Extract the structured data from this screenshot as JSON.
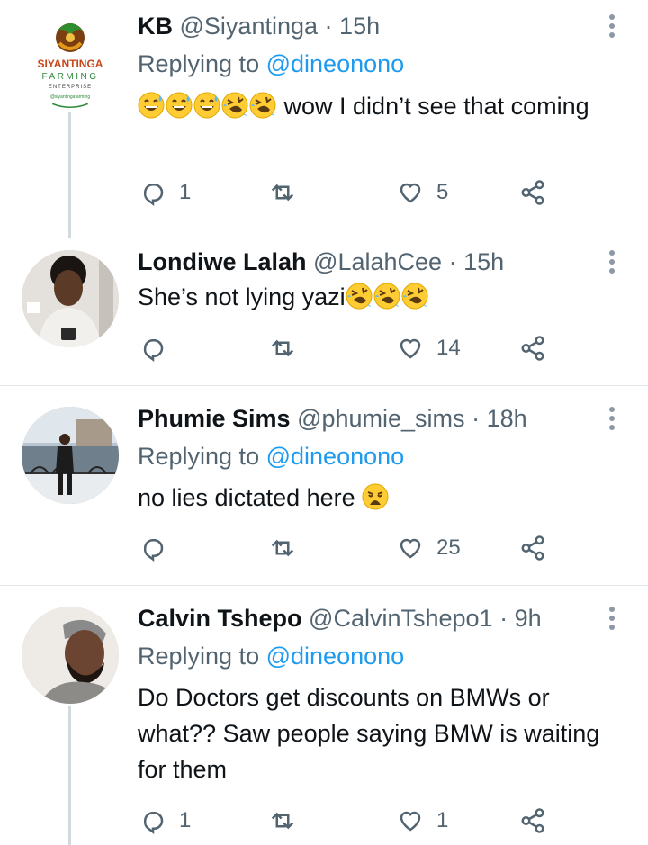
{
  "tweets": [
    {
      "name": "KB",
      "handle": "@Siyantinga",
      "time": "15h",
      "replying_label": "Replying to",
      "replying_handle": "@dineonono",
      "text": "wow I didn’t see that coming",
      "emojis": [
        "grinning-sweat",
        "grinning-sweat",
        "grinning-sweat",
        "rofl",
        "rofl"
      ],
      "replies": "1",
      "retweets": "",
      "likes": "5",
      "avatar_logo": {
        "line1": "SIYANTINGA",
        "line2": "FARMING",
        "line3": "ENTERPRISE",
        "line4": "@siyantingafarming"
      }
    },
    {
      "name": "Londiwe Lalah",
      "handle": "@LalahCee",
      "time": "15h",
      "text": "She’s not lying yazi",
      "emojis": [
        "rofl",
        "rofl",
        "rofl"
      ],
      "replies": "",
      "retweets": "",
      "likes": "14"
    },
    {
      "name": "Phumie Sims",
      "handle": "@phumie_sims",
      "time": "18h",
      "replying_label": "Replying to",
      "replying_handle": "@dineonono",
      "text": "no lies dictated here",
      "emojis": [
        "weary"
      ],
      "replies": "",
      "retweets": "",
      "likes": "25"
    },
    {
      "name": "Calvin Tshepo",
      "handle": "@CalvinTshepo1",
      "time": "9h",
      "replying_label": "Replying to",
      "replying_handle": "@dineonono",
      "text": "Do Doctors get discounts on BMWs or what?? Saw people saying BMW is waiting for them",
      "replies": "1",
      "retweets": "",
      "likes": "1"
    }
  ],
  "separator": "·",
  "colors": {
    "link": "#1d9bf0",
    "secondary": "#536471",
    "icon": "#536471",
    "emoji": "#ffcc33"
  }
}
